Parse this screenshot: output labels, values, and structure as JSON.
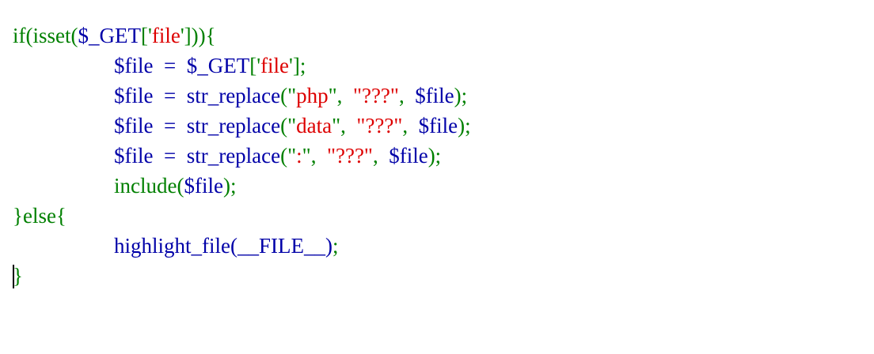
{
  "colors": {
    "keyword": "#008000",
    "variable": "#0000a8",
    "string": "#dd0000",
    "punct": "#008000",
    "background": "#ffffff"
  },
  "lines": [
    {
      "indent": false,
      "tokens": [
        {
          "text": "if(isset(",
          "kind": "keyword"
        },
        {
          "text": "$_GET",
          "kind": "variable"
        },
        {
          "text": "['",
          "kind": "punct"
        },
        {
          "text": "file",
          "kind": "string"
        },
        {
          "text": "'])){",
          "kind": "punct"
        }
      ]
    },
    {
      "indent": true,
      "tokens": [
        {
          "text": "$file  =  $_GET",
          "kind": "variable"
        },
        {
          "text": "['",
          "kind": "punct"
        },
        {
          "text": "file",
          "kind": "string"
        },
        {
          "text": "'];",
          "kind": "punct"
        }
      ]
    },
    {
      "indent": true,
      "tokens": [
        {
          "text": "$file  =  str_replace",
          "kind": "variable"
        },
        {
          "text": "(\"",
          "kind": "punct"
        },
        {
          "text": "php",
          "kind": "string"
        },
        {
          "text": "\",  ",
          "kind": "punct"
        },
        {
          "text": "\"???\"",
          "kind": "string"
        },
        {
          "text": ",  ",
          "kind": "punct"
        },
        {
          "text": "$file",
          "kind": "variable"
        },
        {
          "text": ");",
          "kind": "punct"
        }
      ]
    },
    {
      "indent": true,
      "tokens": [
        {
          "text": "$file  =  str_replace",
          "kind": "variable"
        },
        {
          "text": "(\"",
          "kind": "punct"
        },
        {
          "text": "data",
          "kind": "string"
        },
        {
          "text": "\",  ",
          "kind": "punct"
        },
        {
          "text": "\"???\"",
          "kind": "string"
        },
        {
          "text": ",  ",
          "kind": "punct"
        },
        {
          "text": "$file",
          "kind": "variable"
        },
        {
          "text": ");",
          "kind": "punct"
        }
      ]
    },
    {
      "indent": true,
      "tokens": [
        {
          "text": "$file  =  str_replace",
          "kind": "variable"
        },
        {
          "text": "(\"",
          "kind": "punct"
        },
        {
          "text": ":",
          "kind": "string"
        },
        {
          "text": "\",  ",
          "kind": "punct"
        },
        {
          "text": "\"???\"",
          "kind": "string"
        },
        {
          "text": ",  ",
          "kind": "punct"
        },
        {
          "text": "$file",
          "kind": "variable"
        },
        {
          "text": ");",
          "kind": "punct"
        }
      ]
    },
    {
      "indent": true,
      "tokens": [
        {
          "text": "include(",
          "kind": "keyword"
        },
        {
          "text": "$file",
          "kind": "variable"
        },
        {
          "text": ");",
          "kind": "punct"
        }
      ]
    },
    {
      "indent": false,
      "tokens": [
        {
          "text": "}else{",
          "kind": "keyword"
        }
      ]
    },
    {
      "indent": true,
      "tokens": [
        {
          "text": "highlight_file(__FILE__)",
          "kind": "variable"
        },
        {
          "text": ";",
          "kind": "punct"
        }
      ]
    },
    {
      "indent": false,
      "caret": true,
      "tokens": [
        {
          "text": "}",
          "kind": "keyword"
        }
      ]
    }
  ]
}
